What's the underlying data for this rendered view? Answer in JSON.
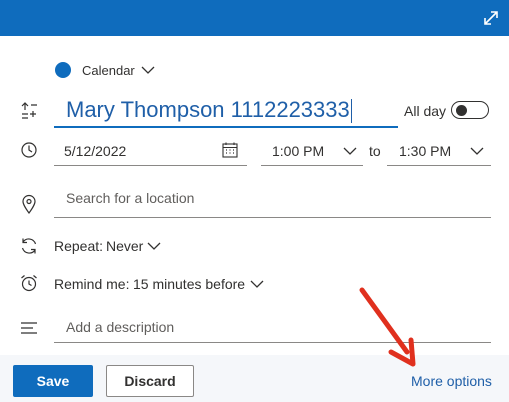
{
  "header": {
    "expand_icon": "expand-icon",
    "accent": "#0f6cbd"
  },
  "calendar": {
    "label": "Calendar",
    "color": "#0f6cbd"
  },
  "event": {
    "title": "Mary Thompson 1112223333",
    "all_day_label": "All day",
    "all_day_on": false
  },
  "datetime": {
    "date": "5/12/2022",
    "start_time": "1:00 PM",
    "to_label": "to",
    "end_time": "1:30 PM"
  },
  "location": {
    "placeholder": "Search for a location"
  },
  "repeat": {
    "label": "Repeat:",
    "value": "Never"
  },
  "reminder": {
    "label": "Remind me:",
    "value": "15 minutes before"
  },
  "description": {
    "placeholder": "Add a description"
  },
  "footer": {
    "save_label": "Save",
    "discard_label": "Discard",
    "more_options_label": "More options"
  },
  "annotation": {
    "arrow_color": "#e0301e"
  }
}
